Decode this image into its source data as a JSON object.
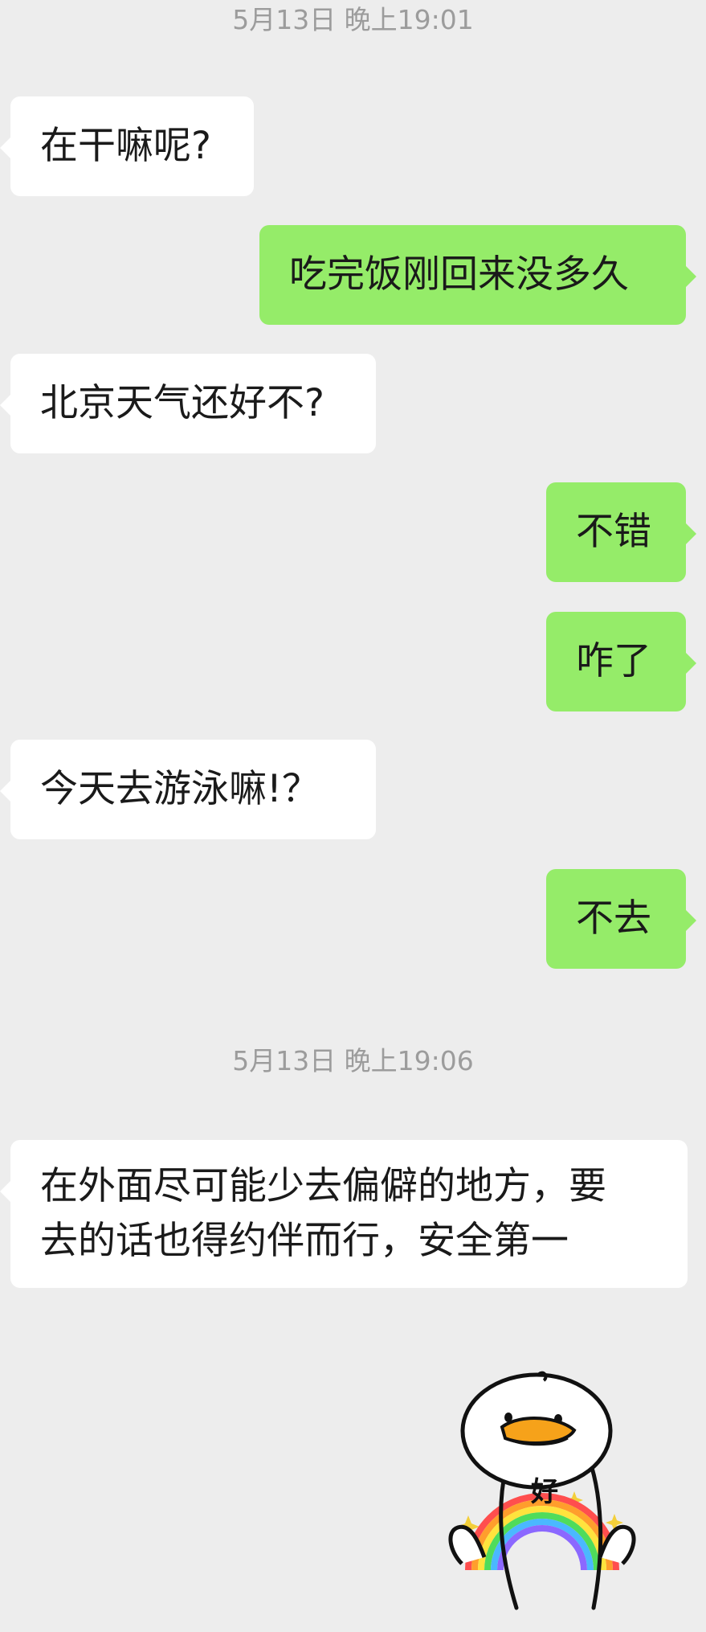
{
  "chat": {
    "timestamp_1": "5月13日 晚上19:01",
    "timestamp_2": "5月13日 晚上19:06",
    "messages": [
      {
        "sender": "other",
        "text": "在干嘛呢?"
      },
      {
        "sender": "me",
        "text": "吃完饭刚回来没多久"
      },
      {
        "sender": "other",
        "text": "北京天气还好不?"
      },
      {
        "sender": "me",
        "text": "不错"
      },
      {
        "sender": "me",
        "text": "咋了"
      },
      {
        "sender": "other",
        "text": "今天去游泳嘛!？"
      },
      {
        "sender": "me",
        "text": "不去"
      },
      {
        "sender": "other",
        "text_line_1": "在外面尽可能少去偏僻的地方，要",
        "text_line_2": "去的话也得约伴而行，安全第一"
      }
    ],
    "sticker": {
      "icon": "duck-rainbow-sticker-icon",
      "text": "好"
    }
  },
  "colors": {
    "background": "#ededed",
    "incoming_bubble": "#ffffff",
    "outgoing_bubble": "#95ec69",
    "timestamp_text": "#9c9c9c"
  }
}
